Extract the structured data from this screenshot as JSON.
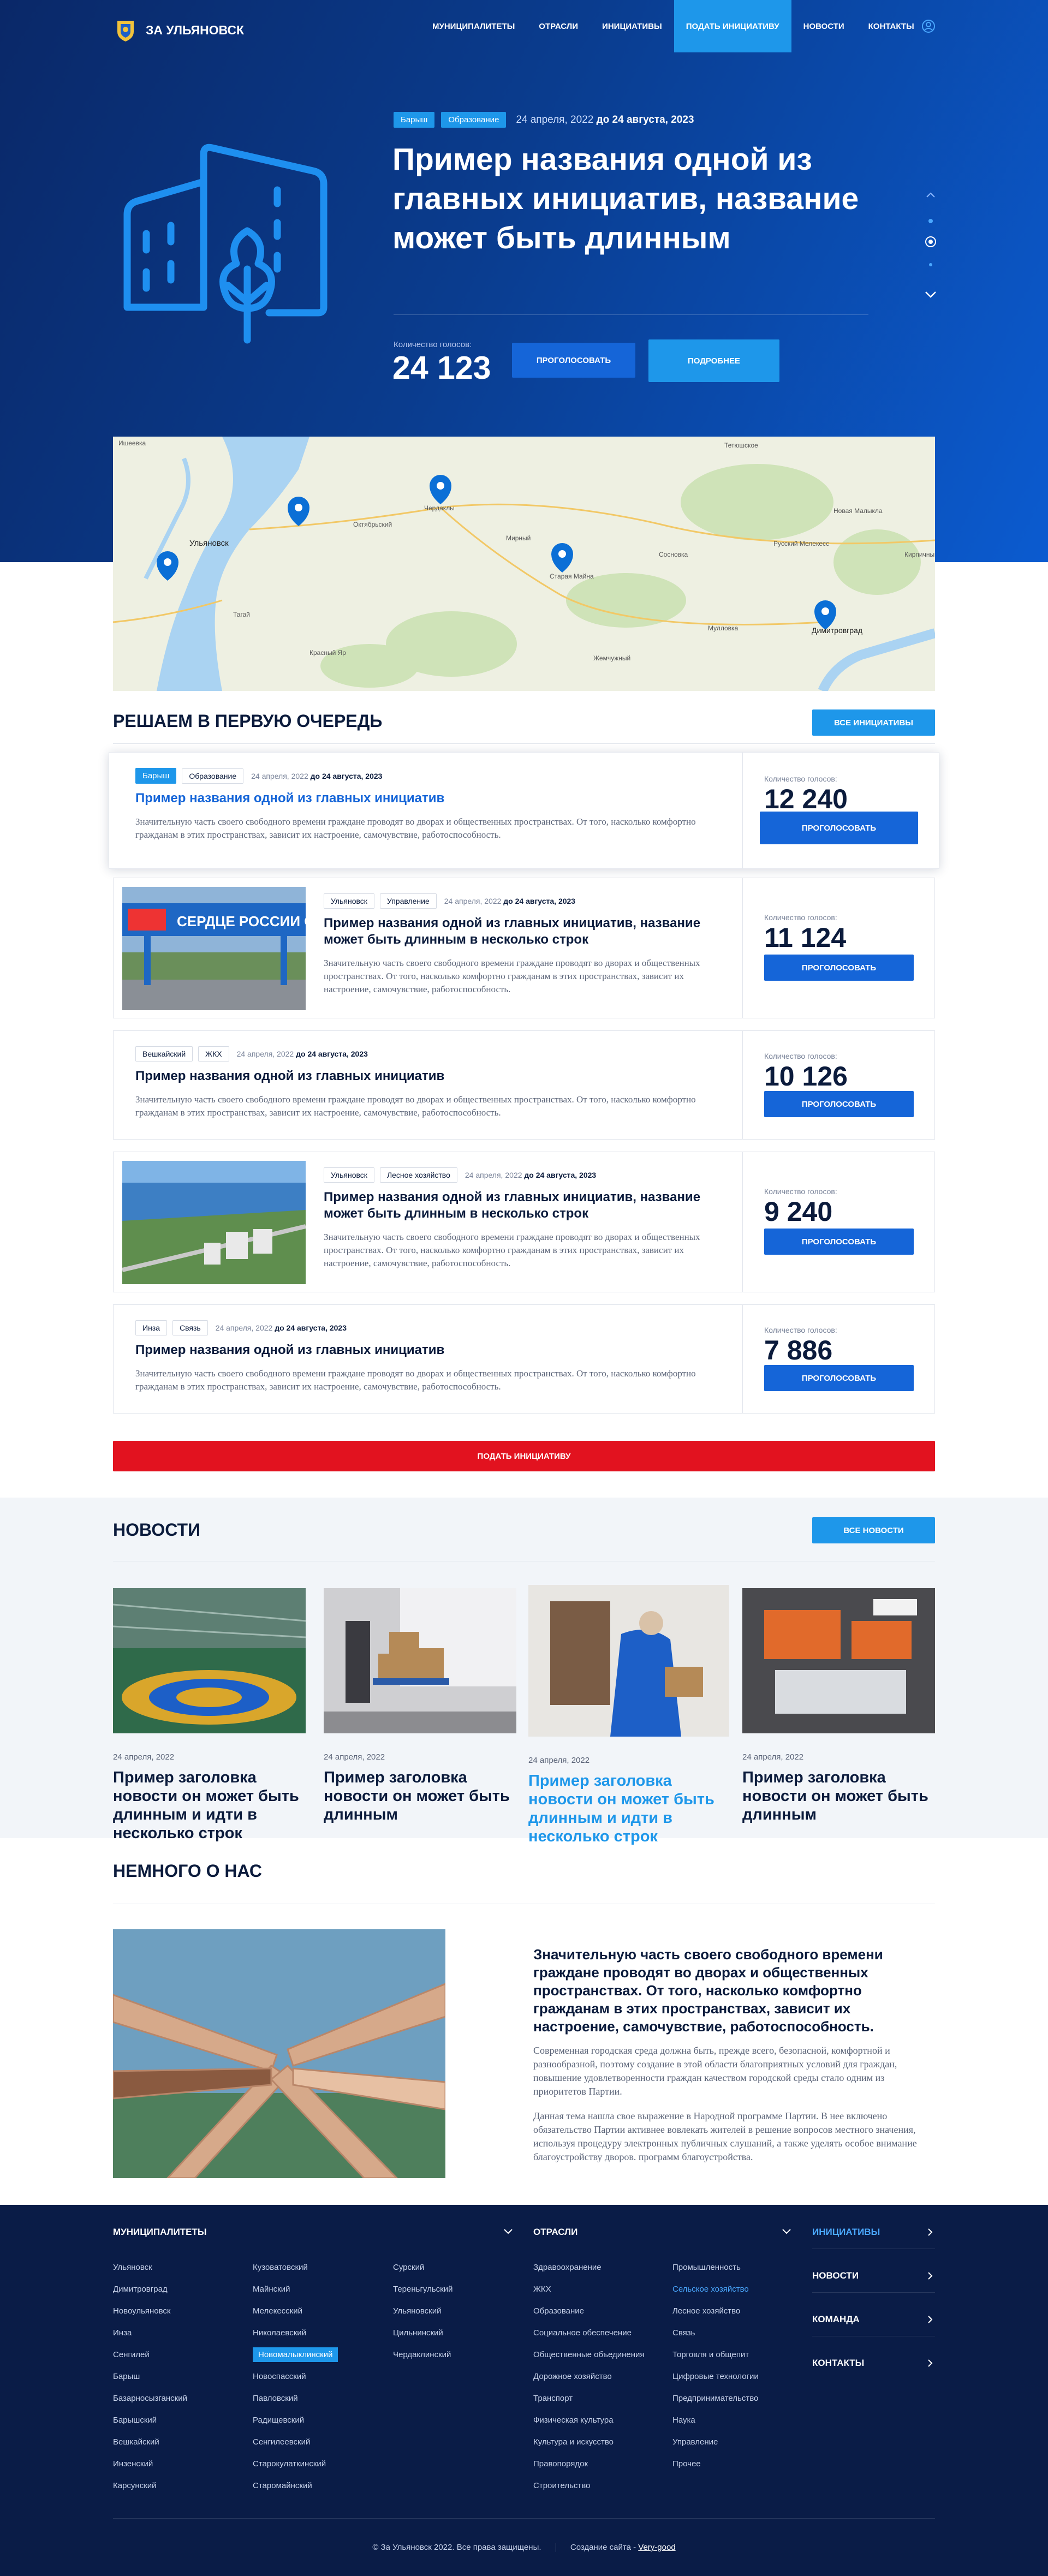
{
  "nav": {
    "brand": "ЗА УЛЬЯНОВСК",
    "items": [
      "МУНИЦИПАЛИТЕТЫ",
      "ОТРАСЛИ",
      "ИНИЦИАТИВЫ",
      "ПОДАТЬ ИНИЦИАТИВУ",
      "НОВОСТИ",
      "КОНТАКТЫ"
    ],
    "active_index": 3
  },
  "hero": {
    "tags": [
      "Барыш",
      "Образование"
    ],
    "date_from": "24 апреля, 2022",
    "date_sep": "до",
    "date_to": "24 августа, 2023",
    "title": "Пример названия одной из главных инициатив, название может быть длинным",
    "votes_label": "Количество голосов:",
    "votes": "24 123",
    "vote_button": "ПРОГОЛОСОВАТЬ",
    "more_button": "ПОДРОБНЕЕ"
  },
  "map": {
    "labels": [
      "Ишеевка",
      "Ульяновск",
      "Чердаклы",
      "Октябрьский",
      "Мирный",
      "Старая Майна",
      "Димитровград",
      "Мулловка",
      "Тагай",
      "Красный Яр",
      "Новая Малыкла",
      "Сосновка",
      "Русский Мелекесс",
      "Кирпичный",
      "Тетюшское",
      "Жемчужный"
    ]
  },
  "priority": {
    "title": "РЕШАЕМ В ПЕРВУЮ ОЧЕРЕДЬ",
    "all_button": "ВСЕ ИНИЦИАТИВЫ",
    "votes_label": "Количество голосов:",
    "vote_button": "ПРОГОЛОСОВАТЬ",
    "submit_button": "ПОДАТЬ ИНИЦИАТИВУ",
    "cards": [
      {
        "tags": [
          "Барыш",
          "Образование"
        ],
        "date_from": "24 апреля, 2022",
        "date_to": "до 24 августа, 2023",
        "title": "Пример названия одной из главных инициатив",
        "text": "Значительную часть своего свободного времени граждане проводят во дворах и общественных пространствах. От того, насколько комфортно гражданам в этих пространствах, зависит их настроение, самочувствие, работоспособность.",
        "votes": "12 240"
      },
      {
        "tags": [
          "Ульяновск",
          "Управление"
        ],
        "date_from": "24 апреля, 2022",
        "date_to": "до 24 августа, 2023",
        "title": "Пример названия одной из главных инициатив, название может быть длинным в несколько строк",
        "text": "Значительную часть своего свободного времени граждане проводят во дворах и общественных пространствах. От того, насколько комфортно гражданам в этих пространствах, зависит их настроение, самочувствие, работоспособность.",
        "votes": "11 124",
        "image_banner": "СЕРДЦЕ РОССИИ ОЛЕНЬИ"
      },
      {
        "tags": [
          "Вешкайский",
          "ЖКХ"
        ],
        "date_from": "24 апреля, 2022",
        "date_to": "до 24 августа, 2023",
        "title": "Пример названия одной из главных инициатив",
        "text": "Значительную часть своего свободного времени граждане проводят во дворах и общественных пространствах. От того, насколько комфортно гражданам в этих пространствах, зависит их настроение, самочувствие, работоспособность.",
        "votes": "10 126"
      },
      {
        "tags": [
          "Ульяновск",
          "Лесное хозяйство"
        ],
        "date_from": "24 апреля, 2022",
        "date_to": "до 24 августа, 2023",
        "title": "Пример названия одной из главных инициатив, название может быть длинным в несколько строк",
        "text": "Значительную часть своего свободного времени граждане проводят во дворах и общественных пространствах. От того, насколько комфортно гражданам в этих пространствах, зависит их настроение, самочувствие, работоспособность.",
        "votes": "9 240"
      },
      {
        "tags": [
          "Инза",
          "Связь"
        ],
        "date_from": "24 апреля, 2022",
        "date_to": "до 24 августа, 2023",
        "title": "Пример названия одной из главных инициатив",
        "text": "Значительную часть своего свободного времени граждане проводят во дворах и общественных пространствах. От того, насколько комфортно гражданам в этих пространствах, зависит их настроение, самочувствие, работоспособность.",
        "votes": "7 886"
      }
    ]
  },
  "news": {
    "title": "НОВОСТИ",
    "all_button": "ВСЕ НОВОСТИ",
    "items": [
      {
        "date": "24 апреля, 2022",
        "title": "Пример заголовка новости он может быть длинным и идти в несколько строк"
      },
      {
        "date": "24 апреля, 2022",
        "title": "Пример заголовка новости он может быть длинным"
      },
      {
        "date": "24 апреля, 2022",
        "title": "Пример заголовка новости он может быть длинным и идти в несколько строк"
      },
      {
        "date": "24 апреля, 2022",
        "title": "Пример заголовка новости он может быть длинным"
      }
    ]
  },
  "about": {
    "title": "НЕМНОГО О НАС",
    "lead": "Значительную часть своего свободного времени граждане проводят во дворах и общественных пространствах. От того, насколько комфортно гражданам в этих пространствах, зависит их настроение, самочувствие, работоспособность.",
    "p1": "Современная городская среда должна быть, прежде всего, безопасной, комфортной и разнообразной, поэтому создание в этой области благоприятных условий для граждан, повышение удовлетворенности граждан качеством городской среды стало одним из приоритетов Партии.",
    "p2": "Данная тема нашла свое выражение в Народной программе Партии. В нее включено обязательство Партии активнее вовлекать жителей в решение вопросов местного значения, используя процедуру электронных публичных слушаний, а также уделять особое внимание благоустройству дворов. программ благоустройства."
  },
  "footer": {
    "municipalities_title": "МУНИЦИПАЛИТЕТЫ",
    "sectors_title": "ОТРАСЛИ",
    "mun_col1": [
      "Ульяновск",
      "Димитровград",
      "Новоульяновск",
      "Инза",
      "Сенгилей",
      "Барыш",
      "Базарносызганский",
      "Барышский",
      "Вешкайский",
      "Инзенский",
      "Карсунский"
    ],
    "mun_col2": [
      "Кузоватовский",
      "Майнский",
      "Мелекесский",
      "Николаевский",
      "Новомалыклинский",
      "Новоспасский",
      "Павловский",
      "Радищевский",
      "Сенгилеевский",
      "Старокулаткинский",
      "Старомайнский"
    ],
    "mun_col3": [
      "Сурский",
      "Тереньгульский",
      "Ульяновский",
      "Цильнинский",
      "Чердаклинский"
    ],
    "sec_col1": [
      "Здравоохранение",
      "ЖКХ",
      "Образование",
      "Социальное обеспечение",
      "Общественные объединения",
      "Дорожное хозяйство",
      "Транспорт",
      "Физическая культура",
      "Культура и искусство",
      "Правопорядок",
      "Строительство"
    ],
    "sec_col2": [
      "Промышленность",
      "Сельское хозяйство",
      "Лесное хозяйство",
      "Связь",
      "Торговля и общепит",
      "Цифровые технологии",
      "Предпринимательство",
      "Наука",
      "Управление",
      "Прочее"
    ],
    "side": [
      "ИНИЦИАТИВЫ",
      "НОВОСТИ",
      "КОМАНДА",
      "КОНТАКТЫ"
    ],
    "copyright": "© За Ульяновск 2022. Все права защищены.",
    "made_by_label": "Создание сайта -",
    "made_by": "Very-good",
    "colors": {
      "accent": "#1e97ea",
      "primary": "#1565d8",
      "red": "#e2121f",
      "navy": "#0a1c47"
    }
  }
}
